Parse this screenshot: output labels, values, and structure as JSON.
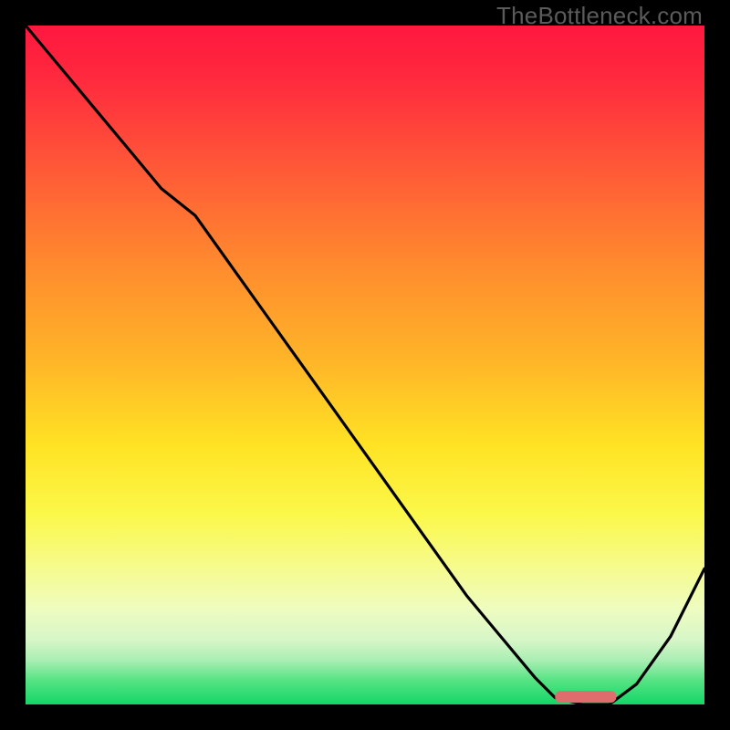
{
  "watermark": "TheBottleneck.com",
  "chart_data": {
    "type": "line",
    "title": "",
    "xlabel": "",
    "ylabel": "",
    "xlim": [
      0,
      100
    ],
    "ylim": [
      0,
      100
    ],
    "series": [
      {
        "name": "bottleneck-curve",
        "x": [
          0,
          5,
          10,
          15,
          20,
          25,
          30,
          35,
          40,
          45,
          50,
          55,
          60,
          65,
          70,
          75,
          78,
          82,
          86,
          90,
          95,
          100
        ],
        "y": [
          100,
          94,
          88,
          82,
          76,
          72,
          65,
          58,
          51,
          44,
          37,
          30,
          23,
          16,
          10,
          4,
          1,
          0,
          0,
          3,
          10,
          20
        ]
      }
    ],
    "marker": {
      "name": "optimal-range",
      "x_start": 78,
      "x_end": 87,
      "y": 1.2
    },
    "gradient_stops": [
      {
        "offset": 0.0,
        "color": "#ff173f"
      },
      {
        "offset": 0.08,
        "color": "#ff2a3e"
      },
      {
        "offset": 0.2,
        "color": "#ff5538"
      },
      {
        "offset": 0.35,
        "color": "#ff8a2e"
      },
      {
        "offset": 0.5,
        "color": "#ffb728"
      },
      {
        "offset": 0.62,
        "color": "#ffe324"
      },
      {
        "offset": 0.72,
        "color": "#fbf84a"
      },
      {
        "offset": 0.8,
        "color": "#f6fb8f"
      },
      {
        "offset": 0.86,
        "color": "#eefcc0"
      },
      {
        "offset": 0.905,
        "color": "#d7f6c8"
      },
      {
        "offset": 0.935,
        "color": "#a9eeb3"
      },
      {
        "offset": 0.965,
        "color": "#55e383"
      },
      {
        "offset": 1.0,
        "color": "#13d667"
      }
    ]
  }
}
